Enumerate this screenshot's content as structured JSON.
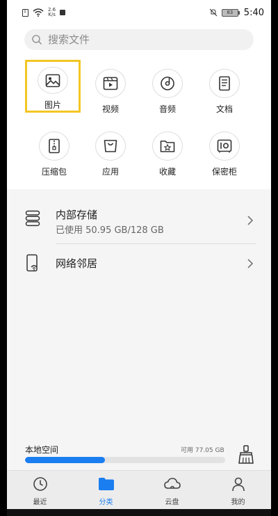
{
  "status_bar": {
    "net_speed_value": "2.6",
    "net_speed_unit": "K/s",
    "battery": "83",
    "time": "5:40"
  },
  "search": {
    "placeholder": "搜索文件"
  },
  "categories": [
    {
      "label": "图片",
      "icon": "image-icon"
    },
    {
      "label": "视频",
      "icon": "video-icon"
    },
    {
      "label": "音频",
      "icon": "music-icon"
    },
    {
      "label": "文档",
      "icon": "document-icon"
    },
    {
      "label": "压缩包",
      "icon": "archive-icon"
    },
    {
      "label": "应用",
      "icon": "app-bag-icon"
    },
    {
      "label": "收藏",
      "icon": "star-folder-icon"
    },
    {
      "label": "保密柜",
      "icon": "safe-icon"
    }
  ],
  "storage": {
    "internal_title": "内部存储",
    "internal_usage": "已使用 50.95 GB/128 GB",
    "network_title": "网络邻居"
  },
  "local_space": {
    "label": "本地空间",
    "free": "可用 77.05 GB",
    "used_fraction": 0.398
  },
  "bottom_nav": [
    {
      "label": "最近",
      "icon": "clock-icon"
    },
    {
      "label": "分类",
      "icon": "folder-icon"
    },
    {
      "label": "云盘",
      "icon": "cloud-icon"
    },
    {
      "label": "我的",
      "icon": "person-icon"
    }
  ],
  "colors": {
    "accent": "#1a7ef0",
    "selection": "#f3c622"
  }
}
